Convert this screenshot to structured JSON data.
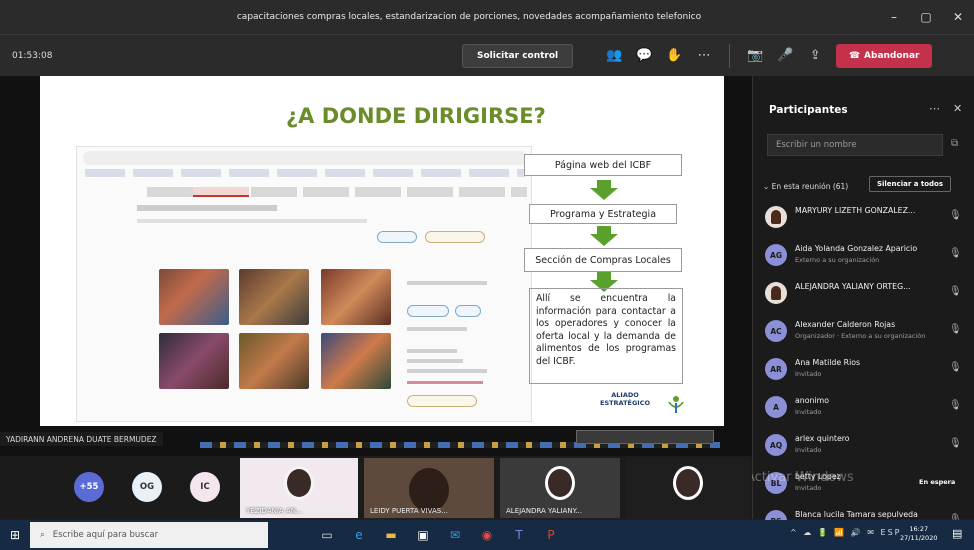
{
  "window": {
    "title": "capacitaciones compras locales, estandarizacion de porciones, novedades acompañamiento telefonico",
    "controls": [
      "–",
      "▢",
      "✕"
    ]
  },
  "toolbar": {
    "timer": "01:53:08",
    "request_control_label": "Solicitar control",
    "leave_label": "Abandonar",
    "colors": {
      "leave": "#c4314b"
    }
  },
  "slide": {
    "heading": "¿A DONDE DIRIGIRSE?",
    "flow": [
      "Página web del ICBF",
      "Programa y Estrategia",
      "Sección de Compras Locales"
    ],
    "description": "Allí se encuentra la información para contactar a los operadores y conocer la oferta local y la demanda de alimentos de los programas del ICBF.",
    "aliado": [
      "ALIADO",
      "ESTRATÉGICO"
    ],
    "accent_color": "#6b8c2a"
  },
  "presenter_label": "YADIRANN ANDRENA DUATE BERMUDEZ",
  "participants": {
    "title": "Participantes",
    "search_placeholder": "Escribir un nombre",
    "section_label": "En esta reunión (61)",
    "mute_all_label": "Silenciar a todos",
    "people": [
      {
        "initials": "",
        "name": "MARYURY LIZETH GONZALEZ...",
        "role": "",
        "photo": true
      },
      {
        "initials": "AG",
        "name": "Aida Yolanda Gonzalez Aparicio",
        "role": "Externo a su organización",
        "photo": false
      },
      {
        "initials": "",
        "name": "ALEJANDRA YALIANY ORTEG...",
        "role": "",
        "photo": true
      },
      {
        "initials": "AC",
        "name": "Alexander Calderon Rojas",
        "role": "Organizador · Externo a su organización",
        "photo": false
      },
      {
        "initials": "AR",
        "name": "Ana Matilde Rios",
        "role": "Invitado",
        "photo": false
      },
      {
        "initials": "A",
        "name": "anonimo",
        "role": "Invitado",
        "photo": false
      },
      {
        "initials": "AQ",
        "name": "arlex quintero",
        "role": "Invitado",
        "photo": false
      },
      {
        "initials": "BL",
        "name": "betty Lopez",
        "role": "Invitado",
        "photo": false,
        "status": "En espera"
      },
      {
        "initials": "BS",
        "name": "Blanca lucila Tamara sepulveda",
        "role": "Invitado",
        "photo": false
      }
    ]
  },
  "watermark": "Activar Windows",
  "gallery": {
    "circles": [
      {
        "label": "+55",
        "bg": "#5a6bd6",
        "fg": "#fff"
      },
      {
        "label": "OG",
        "bg": "#e8f0f8",
        "fg": "#333"
      },
      {
        "label": "IC",
        "bg": "#f4e6ef",
        "fg": "#333"
      }
    ],
    "tiles": [
      {
        "label": "YEZIDANIA AN..."
      },
      {
        "label": "LEIDY PUERTA VIVAS..."
      },
      {
        "label": "ALEJANDRA YALIANY..."
      },
      {
        "label": ""
      }
    ]
  },
  "taskbar": {
    "search_placeholder": "Escribe aquí para buscar",
    "lang": "ESP",
    "time": "16:27",
    "date": "27/11/2020"
  }
}
